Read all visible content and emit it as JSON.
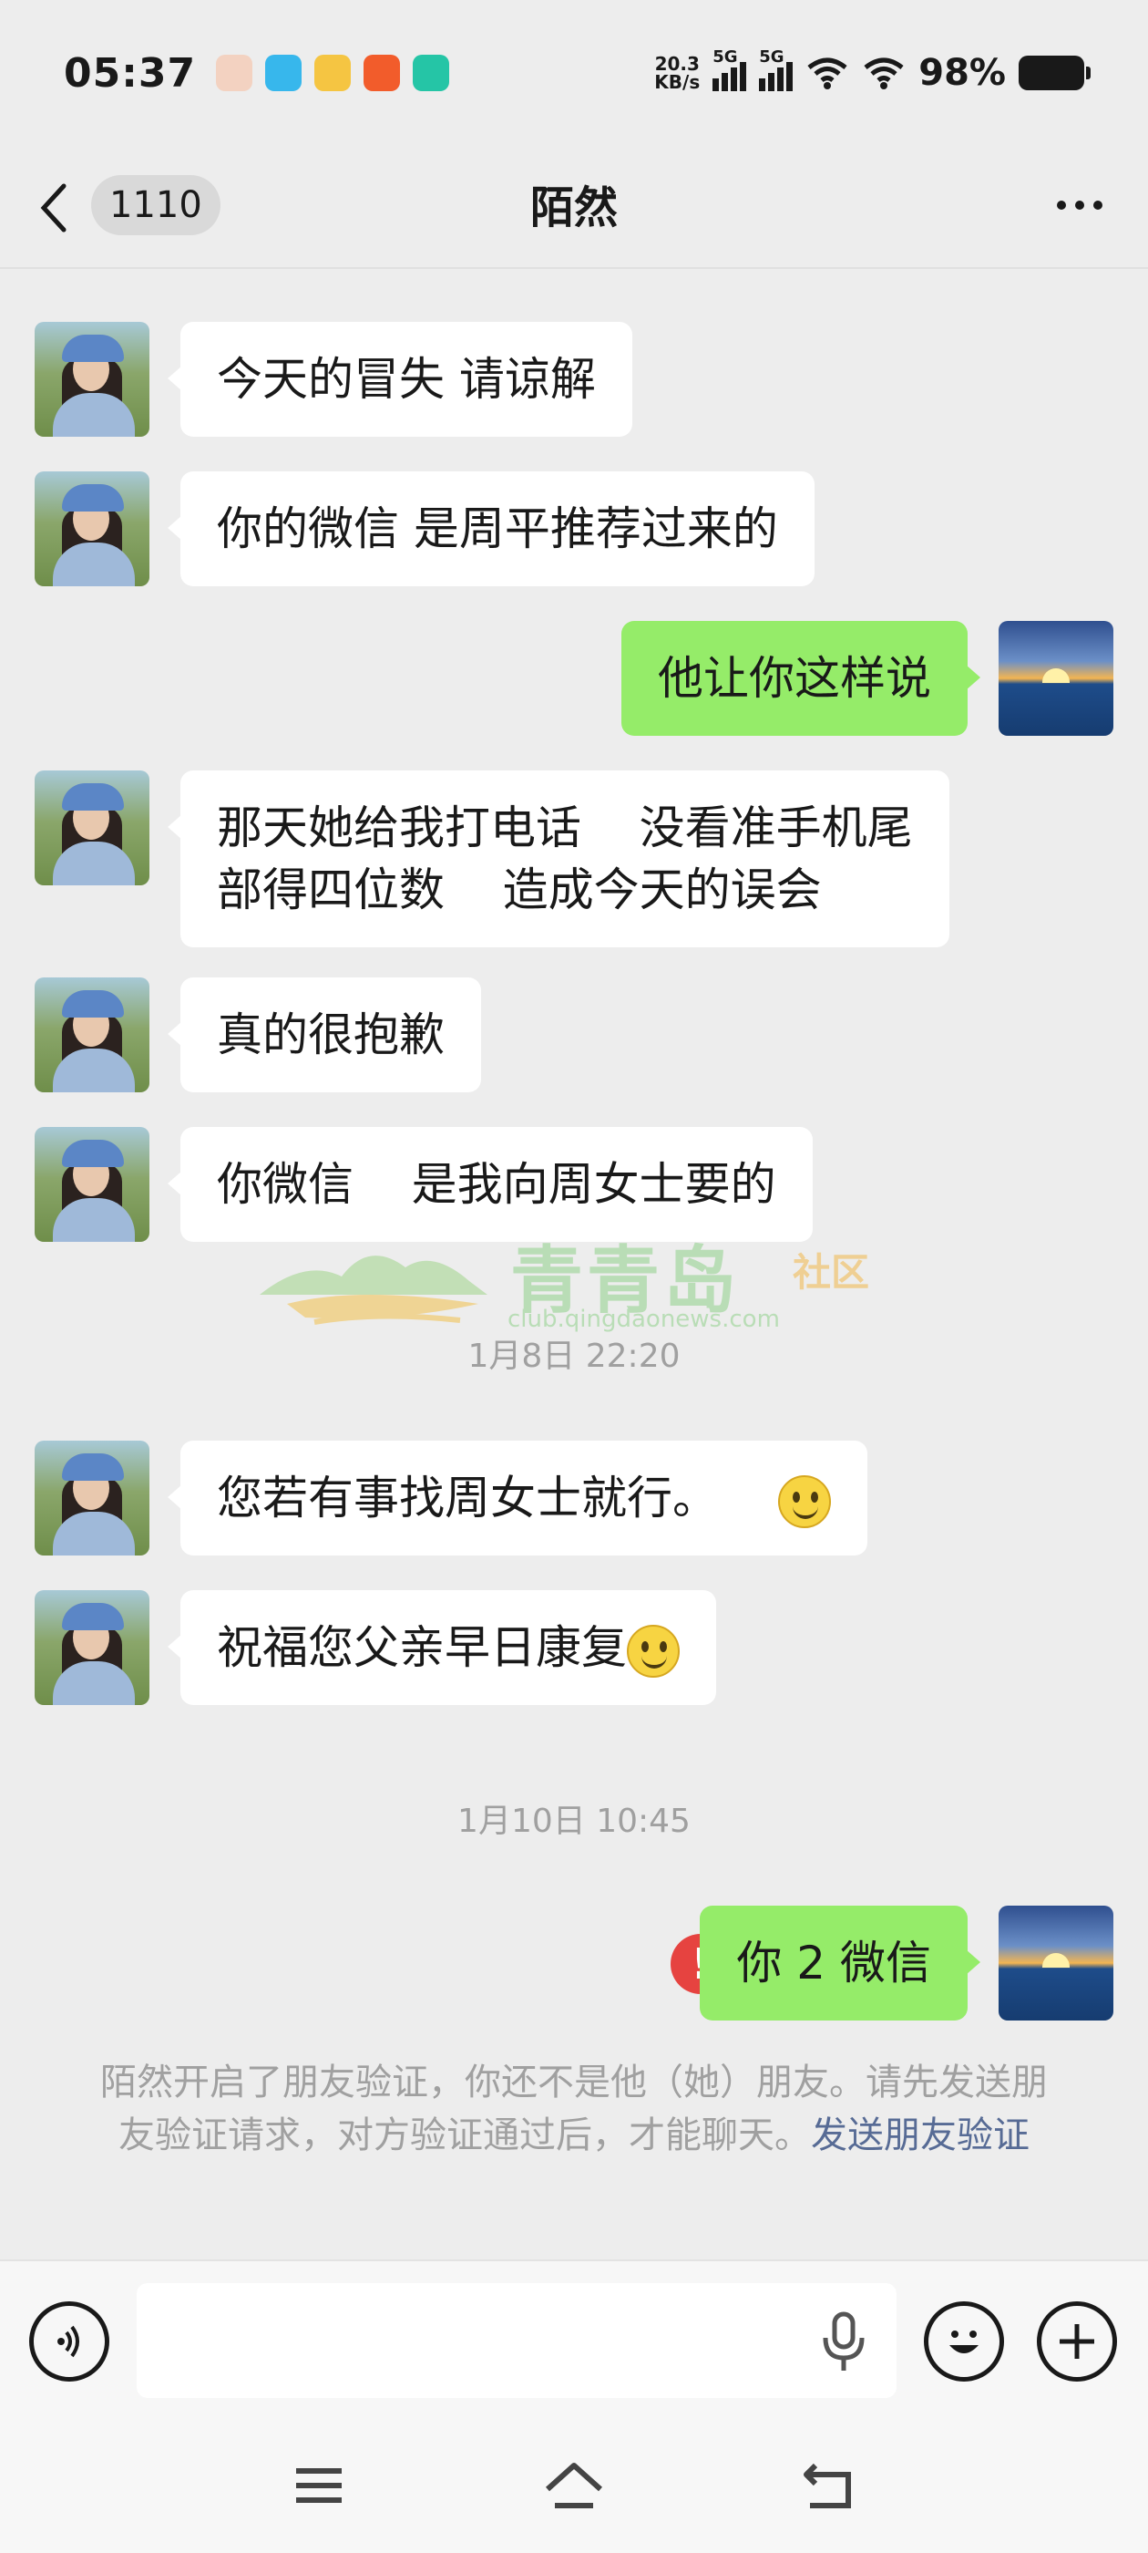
{
  "status_bar": {
    "time": "05:37",
    "net_speed_value": "20.3",
    "net_speed_unit": "KB/s",
    "signal1_label": "5G",
    "signal2_label": "5G",
    "battery": "98%"
  },
  "header": {
    "unread_count": "1110",
    "title": "陌然"
  },
  "messages": [
    {
      "from": "contact",
      "text": "今天的冒失  请谅解"
    },
    {
      "from": "contact",
      "text": "你的微信  是周平推荐过来的"
    },
    {
      "from": "me",
      "text": "他让你这样说"
    },
    {
      "from": "contact",
      "line1": "那天她给我打电话    没看准手机尾",
      "line2": "部得四位数    造成今天的误会"
    },
    {
      "from": "contact",
      "text": "真的很抱歉"
    },
    {
      "from": "contact",
      "text": "你微信    是我向周女士要的"
    },
    {
      "from": "contact",
      "text": "您若有事找周女士就行。",
      "emoji": "smile-emoji"
    },
    {
      "from": "contact",
      "text": "祝福您父亲早日康复",
      "emoji": "smile-emoji"
    },
    {
      "from": "me",
      "text": "你 2 微信",
      "status": "failed"
    }
  ],
  "timestamps": [
    "1月8日 22:20",
    "1月10日 10:45"
  ],
  "error_mark": "!",
  "system_notice": {
    "text": "陌然开启了朋友验证，你还不是他（她）朋友。请先发送朋友验证请求，对方验证通过后，才能聊天。",
    "link": "发送朋友验证"
  },
  "watermark": {
    "title": "青青岛",
    "subtitle": "社区",
    "url": "club.qingdaonews.com"
  },
  "input_bar": {
    "placeholder": ""
  },
  "colors": {
    "background": "#ededed",
    "my_bubble": "#95ec69",
    "their_bubble": "#ffffff",
    "link": "#576b95",
    "error": "#e64340"
  }
}
